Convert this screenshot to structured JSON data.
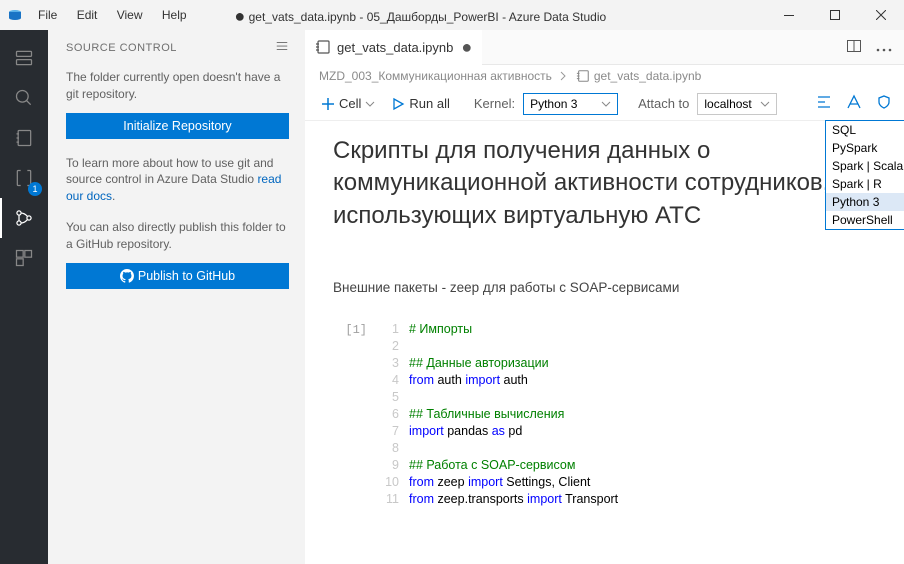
{
  "title": {
    "file": "get_vats_data.ipynb",
    "folder": "05_Дашборды_PowerBI",
    "app": "Azure Data Studio"
  },
  "menu": {
    "file": "File",
    "edit": "Edit",
    "view": "View",
    "help": "Help"
  },
  "activity": {
    "badge": "1"
  },
  "scm": {
    "title": "SOURCE CONTROL",
    "no_repo": "The folder currently open doesn't have a git repository.",
    "init": "Initialize Repository",
    "learn1": "To learn more about how to use git and source control in Azure Data Studio ",
    "learn_link": "read our docs",
    "learn2": ".",
    "pub_text": "You can also directly publish this folder to a GitHub repository.",
    "pub_btn": "Publish to GitHub"
  },
  "tab": {
    "name": "get_vats_data.ipynb"
  },
  "breadcrumbs": {
    "folder": "MZD_003_Коммуникационная активность",
    "file": "get_vats_data.ipynb"
  },
  "toolbar": {
    "cell": "Cell",
    "runall": "Run all",
    "kernel_label": "Kernel:",
    "kernel_value": "Python 3",
    "attach_label": "Attach to",
    "attach_value": "localhost"
  },
  "kernel_options": {
    "sql": "SQL",
    "pyspark": "PySpark",
    "sscala": "Spark | Scala",
    "sr": "Spark | R",
    "py3": "Python 3",
    "ps": "PowerShell"
  },
  "doc": {
    "title": "Скрипты для пол                     данных о коммуникационн                ктивности сотрудников, использующих виртуальную АТС",
    "title_raw": "Скрипты для получения данных о коммуникационной активности сотрудников, использующих виртуальную АТС",
    "para": "Внешние пакеты - zeep для работы с SOAP-сервисами"
  },
  "cell1": {
    "prompt": "[1]",
    "lines": {
      "1": "# Импорты",
      "2": "",
      "3": "## Данные авторизации",
      "5": "",
      "6": "## Табличные вычисления",
      "8": "",
      "9": "## Работа с SOAP-сервисом"
    },
    "tok": {
      "from": "from",
      "import": "import",
      "as": "as",
      "auth": "auth",
      "pandas": "pandas",
      "pd": "pd",
      "zeep": "zeep",
      "settings": "Settings",
      "client": "Client",
      "zt": "zeep.transports",
      "transport": "Transport"
    }
  }
}
